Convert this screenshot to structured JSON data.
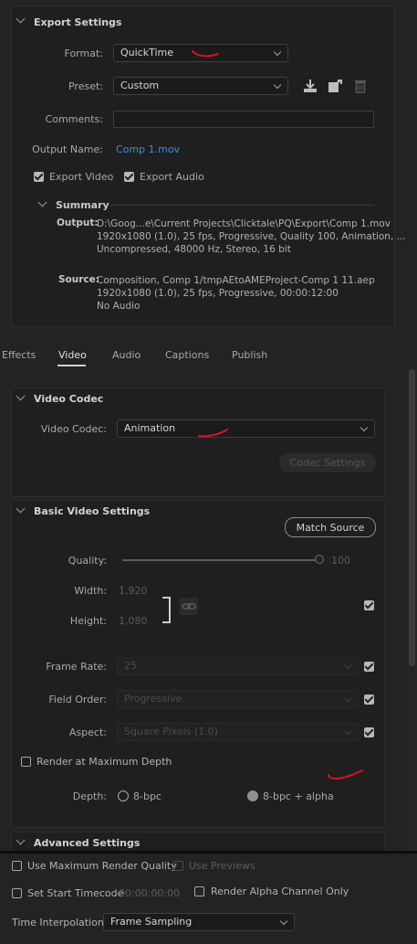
{
  "export_settings": {
    "title": "Export Settings",
    "format_label": "Format:",
    "format_value": "QuickTime",
    "preset_label": "Preset:",
    "preset_value": "Custom",
    "comments_label": "Comments:",
    "comments_value": "",
    "output_name_label": "Output Name:",
    "output_name_value": "Comp 1.mov",
    "export_video_label": "Export Video",
    "export_audio_label": "Export Audio",
    "summary_title": "Summary",
    "output_key": "Output:",
    "output_lines": "D:\\Goog...e\\Current Projects\\Clicktale\\PQ\\Export\\Comp 1.mov\n1920x1080 (1.0), 25 fps, Progressive, Quality 100, Animation, ...\nUncompressed, 48000 Hz, Stereo, 16 bit",
    "source_key": "Source:",
    "source_lines": "Composition, Comp 1/tmpAEtoAMEProject-Comp 1 11.aep\n1920x1080 (1.0), 25 fps, Progressive, 00:00:12:00\nNo Audio"
  },
  "tabs": [
    "Effects",
    "Video",
    "Audio",
    "Captions",
    "Publish"
  ],
  "active_tab": "Video",
  "video_codec": {
    "title": "Video Codec",
    "codec_label": "Video Codec:",
    "codec_value": "Animation",
    "codec_settings_label": "Codec Settings"
  },
  "basic_video": {
    "title": "Basic Video Settings",
    "match_source_label": "Match Source",
    "quality_label": "Quality:",
    "quality_value": "100",
    "quality_fraction": 1.0,
    "width_label": "Width:",
    "width_value": "1,920",
    "height_label": "Height:",
    "height_value": "1,080",
    "frame_rate_label": "Frame Rate:",
    "frame_rate_value": "25",
    "field_order_label": "Field Order:",
    "field_order_value": "Progressive",
    "aspect_label": "Aspect:",
    "aspect_value": "Square Pixels (1.0)",
    "render_max_depth_label": "Render at Maximum Depth",
    "depth_label": "Depth:",
    "depth_option_1": "8-bpc",
    "depth_option_2": "8-bpc + alpha"
  },
  "advanced_settings_title": "Advanced Settings",
  "bottom": {
    "max_render_quality_label": "Use Maximum Render Quality",
    "use_previews_label": "Use Previews",
    "set_start_timecode_label": "Set Start Timecode",
    "timecode_value": "00:00:00:00",
    "render_alpha_label": "Render Alpha Channel Only",
    "time_interp_label": "Time Interpolation:",
    "time_interp_value": "Frame Sampling"
  },
  "colors": {
    "background": "#232323",
    "panel": "#1f1f1f",
    "link_blue": "#3d8fd8",
    "annotation_red": "#d8151a"
  }
}
